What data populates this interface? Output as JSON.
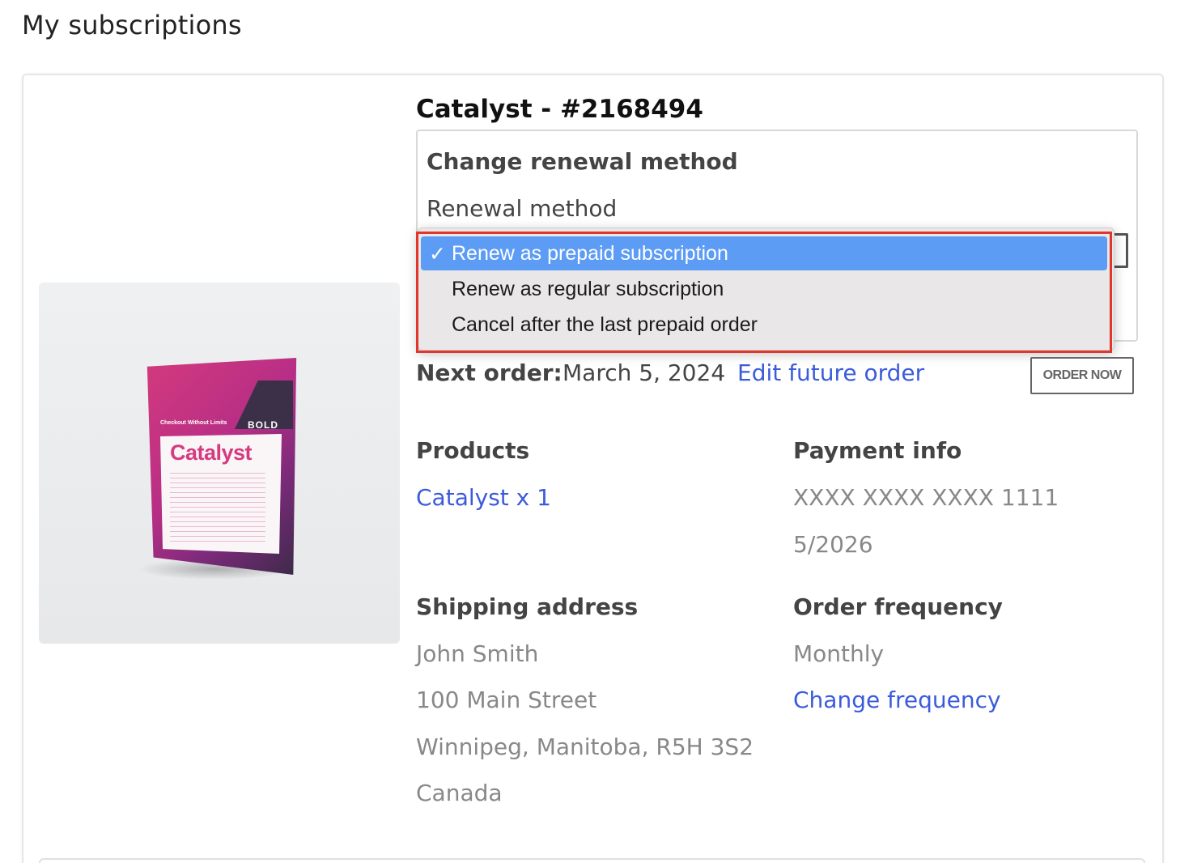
{
  "page": {
    "title": "My subscriptions"
  },
  "subscription": {
    "title": "Catalyst - #2168494",
    "image": {
      "product_name": "Catalyst",
      "brand": "BOLD",
      "tagline": "Checkout Without Limits"
    },
    "renewal": {
      "heading": "Change renewal method",
      "field_label": "Renewal method",
      "options": [
        {
          "label": "Renew as prepaid subscription",
          "selected": true
        },
        {
          "label": "Renew as regular subscription",
          "selected": false
        },
        {
          "label": "Cancel after the last prepaid order",
          "selected": false
        }
      ],
      "check_glyph": "✓"
    },
    "next_order": {
      "label": "Next order:",
      "date": "March 5, 2024",
      "edit_link": "Edit future order",
      "order_now": "ORDER NOW"
    },
    "products": {
      "heading": "Products",
      "items": [
        "Catalyst x 1"
      ]
    },
    "payment": {
      "heading": "Payment info",
      "card": "XXXX XXXX XXXX 1111",
      "expiry": "5/2026"
    },
    "shipping": {
      "heading": "Shipping address",
      "name": "John Smith",
      "street": "100 Main Street",
      "city_line": "Winnipeg, Manitoba, R5H 3S2",
      "country": "Canada"
    },
    "frequency": {
      "heading": "Order frequency",
      "value": "Monthly",
      "change_link": "Change frequency"
    }
  },
  "colors": {
    "link": "#3b5bdb",
    "selected_option": "#5d9cf5",
    "highlight_border": "#e0362b"
  }
}
